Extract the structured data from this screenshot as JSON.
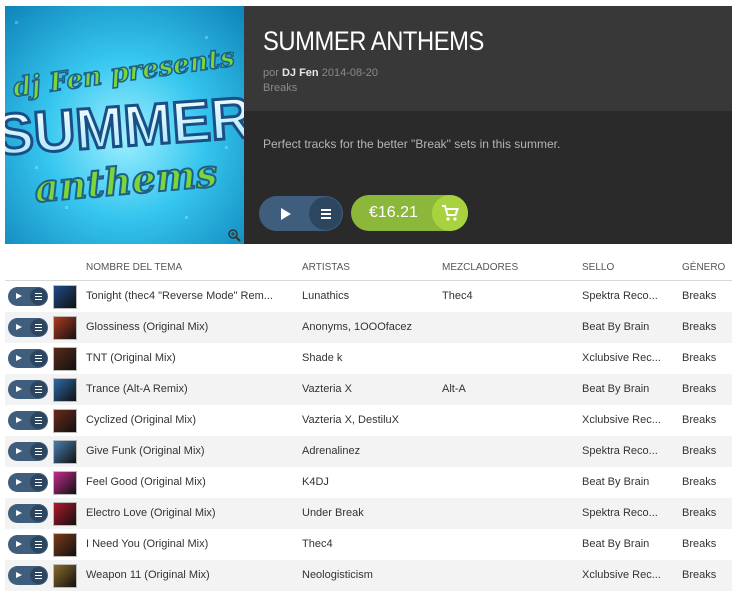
{
  "release": {
    "cover_text_line1": "dj Fen presents",
    "cover_text_line2": "SUMMER",
    "cover_text_line3": "anthems",
    "title": "SUMMER ANTHEMS",
    "by_prefix": "por",
    "artist": "DJ Fen",
    "date": "2014-08-20",
    "genre": "Breaks",
    "description": "Perfect tracks for the better \"Break\" sets in this summer.",
    "price": "€16.21",
    "icons": {
      "play": "play-icon",
      "queue": "queue-icon",
      "cart": "cart-icon",
      "zoom": "zoom-icon"
    }
  },
  "table": {
    "headers": {
      "title": "NOMBRE DEL TEMA",
      "artists": "ARTISTAS",
      "mixers": "MEZCLADORES",
      "label": "SELLO",
      "genre": "GÉNERO"
    },
    "rows": [
      {
        "title": "Tonight (thec4 \"Reverse Mode\" Rem...",
        "artists": "Lunathics",
        "mixers": "Thec4",
        "label": "Spektra Reco...",
        "genre": "Breaks",
        "thumb_color": "#1f4a8a"
      },
      {
        "title": "Glossiness (Original Mix)",
        "artists": "Anonyms, 1OOOfacez",
        "mixers": "",
        "label": "Beat By Brain",
        "genre": "Breaks",
        "thumb_color": "#b03a1e"
      },
      {
        "title": "TNT (Original Mix)",
        "artists": "Shade k",
        "mixers": "",
        "label": "Xclubsive Rec...",
        "genre": "Breaks",
        "thumb_color": "#5a2a1a"
      },
      {
        "title": "Trance (Alt-A Remix)",
        "artists": "Vazteria X",
        "mixers": "Alt-A",
        "label": "Beat By Brain",
        "genre": "Breaks",
        "thumb_color": "#2a6aa8"
      },
      {
        "title": "Cyclized (Original Mix)",
        "artists": "Vazteria X, DestiluX",
        "mixers": "",
        "label": "Xclubsive Rec...",
        "genre": "Breaks",
        "thumb_color": "#6a2a1a"
      },
      {
        "title": "Give Funk (Original Mix)",
        "artists": "Adrenalinez",
        "mixers": "",
        "label": "Spektra Reco...",
        "genre": "Breaks",
        "thumb_color": "#4a7fb0"
      },
      {
        "title": "Feel Good (Original Mix)",
        "artists": "K4DJ",
        "mixers": "",
        "label": "Beat By Brain",
        "genre": "Breaks",
        "thumb_color": "#c22a8a"
      },
      {
        "title": "Electro Love (Original Mix)",
        "artists": "Under Break",
        "mixers": "",
        "label": "Spektra Reco...",
        "genre": "Breaks",
        "thumb_color": "#b0182a"
      },
      {
        "title": "I Need You (Original Mix)",
        "artists": "Thec4",
        "mixers": "",
        "label": "Beat By Brain",
        "genre": "Breaks",
        "thumb_color": "#7a3a1a"
      },
      {
        "title": "Weapon 11 (Original Mix)",
        "artists": "Neologisticism",
        "mixers": "",
        "label": "Xclubsive Rec...",
        "genre": "Breaks",
        "thumb_color": "#8a6a2a"
      }
    ]
  }
}
